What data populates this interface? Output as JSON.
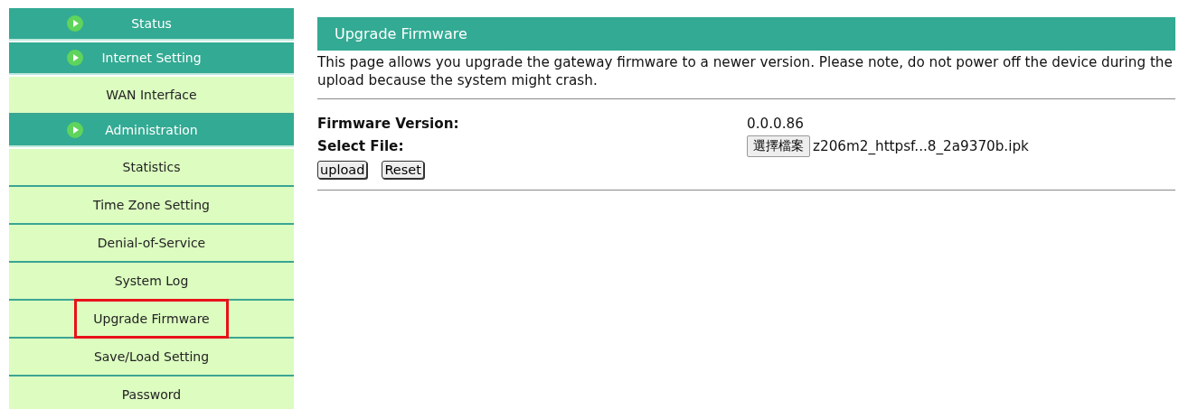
{
  "sidebar": {
    "groups": [
      {
        "label": "Status"
      },
      {
        "label": "Internet Setting",
        "items": [
          {
            "label": "WAN Interface",
            "highlighted": false
          }
        ]
      },
      {
        "label": "Administration",
        "items": [
          {
            "label": "Statistics",
            "highlighted": false
          },
          {
            "label": "Time Zone Setting",
            "highlighted": false
          },
          {
            "label": "Denial-of-Service",
            "highlighted": false
          },
          {
            "label": "System Log",
            "highlighted": false
          },
          {
            "label": "Upgrade Firmware",
            "highlighted": true
          },
          {
            "label": "Save/Load Setting",
            "highlighted": false
          },
          {
            "label": "Password",
            "highlighted": false
          }
        ]
      }
    ]
  },
  "content": {
    "title": "Upgrade Firmware",
    "description": "This page allows you upgrade the gateway firmware to a newer version. Please note, do not power off the device during the upload because the system might crash.",
    "fields": [
      {
        "label": "Firmware Version:",
        "value": "0.0.0.86"
      },
      {
        "label": "Select File:",
        "button": "選擇檔案",
        "file": "z206m2_httpsf...8_2a9370b.ipk"
      }
    ],
    "buttons": [
      "upload",
      "Reset"
    ]
  }
}
